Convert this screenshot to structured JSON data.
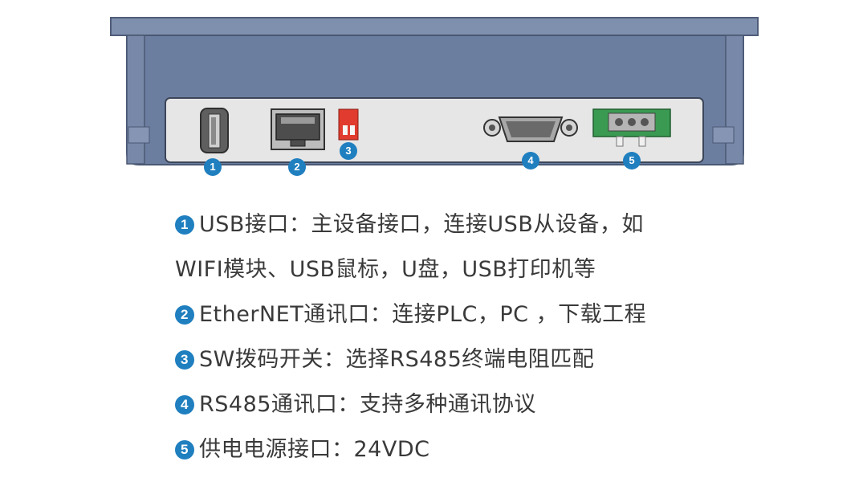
{
  "ports": [
    {
      "num": "1",
      "name": "usb-port"
    },
    {
      "num": "2",
      "name": "ethernet-port"
    },
    {
      "num": "3",
      "name": "dip-switch"
    },
    {
      "num": "4",
      "name": "rs485-port"
    },
    {
      "num": "5",
      "name": "power-terminal"
    }
  ],
  "legend": [
    {
      "num": "1",
      "lines": [
        "USB接口：主设备接口，连接USB从设备，如",
        "WIFI模块、USB鼠标，U盘，USB打印机等"
      ]
    },
    {
      "num": "2",
      "lines": [
        "EtherNET通讯口：连接PLC，PC ，下载工程"
      ]
    },
    {
      "num": "3",
      "lines": [
        "SW拨码开关：选择RS485终端电阻匹配"
      ]
    },
    {
      "num": "4",
      "lines": [
        "RS485通讯口：支持多种通讯协议"
      ]
    },
    {
      "num": "5",
      "lines": [
        "供电电源接口：24VDC"
      ]
    }
  ],
  "colors": {
    "badge": "#1f7fbf",
    "housing": "#6c7ea0",
    "panel": "#e6e6e6",
    "terminal": "#3a9a52",
    "switch": "#e03b2e"
  }
}
